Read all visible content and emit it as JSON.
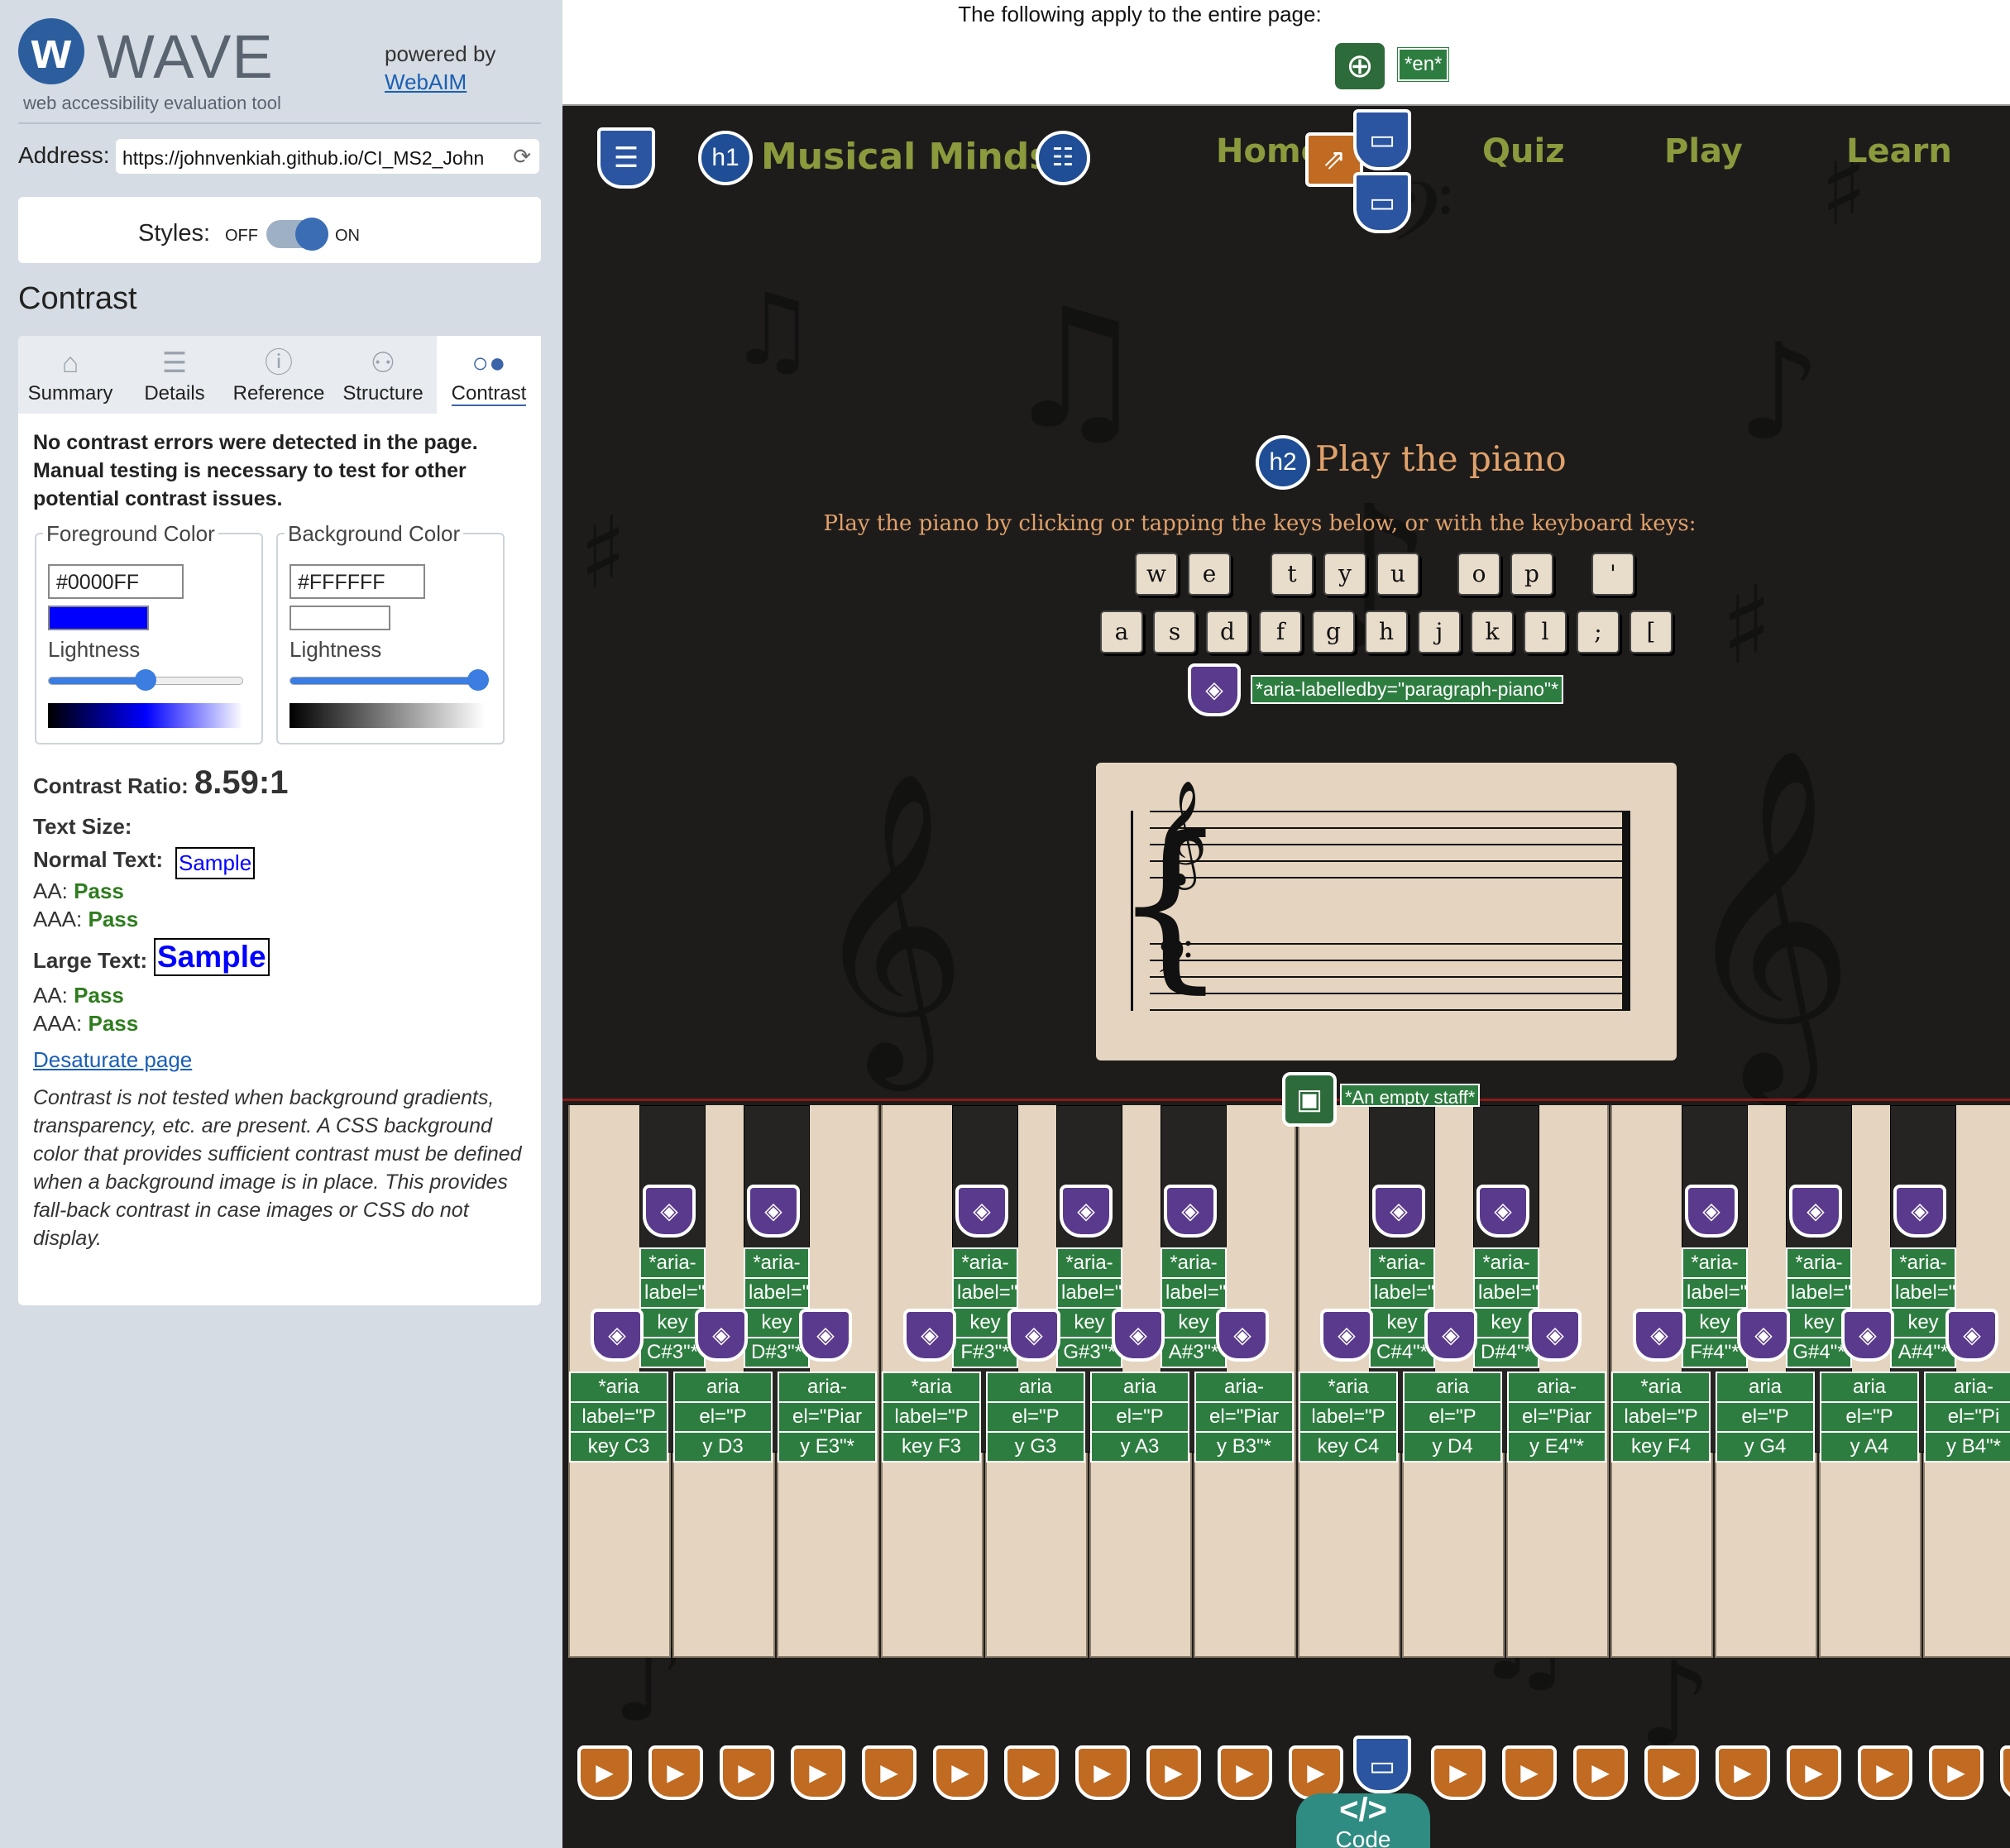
{
  "sidebar": {
    "logo_word": "WAVE",
    "logo_sub": "web accessibility evaluation tool",
    "powered_by": "powered by",
    "powered_link": "WebAIM",
    "address_label": "Address:",
    "address_value": "https://johnvenkiah.github.io/CI_MS2_John",
    "styles_label": "Styles:",
    "styles_off": "OFF",
    "styles_on": "ON",
    "panel_title": "Contrast",
    "tabs": [
      {
        "label": "Summary",
        "icon": "home-icon"
      },
      {
        "label": "Details",
        "icon": "list-icon"
      },
      {
        "label": "Reference",
        "icon": "info-icon"
      },
      {
        "label": "Structure",
        "icon": "structure-icon"
      },
      {
        "label": "Contrast",
        "icon": "contrast-icon"
      }
    ],
    "message": "No contrast errors were detected in the page. Manual testing is necessary to test for other potential contrast issues.",
    "foreground": {
      "legend": "Foreground Color",
      "hex": "#0000FF",
      "lightness_label": "Lightness",
      "lightness": 0.5
    },
    "background": {
      "legend": "Background Color",
      "hex": "#FFFFFF",
      "lightness_label": "Lightness",
      "lightness": 0.97
    },
    "ratio_label": "Contrast Ratio:",
    "ratio_value": "8.59:1",
    "text_size_label": "Text Size:",
    "normal_text_label": "Normal Text:",
    "sample": "Sample",
    "normal_aa_label": "AA:",
    "normal_aa": "Pass",
    "normal_aaa_label": "AAA:",
    "normal_aaa": "Pass",
    "large_text_label": "Large Text:",
    "large_aa_label": "AA:",
    "large_aa": "Pass",
    "large_aaa_label": "AAA:",
    "large_aaa": "Pass",
    "desaturate": "Desaturate page",
    "note": "Contrast is not tested when background gradients, transparency, etc. are present. A CSS background color that provides sufficient contrast must be defined when a background image is in place. This provides fall-back contrast in case images or CSS do not display."
  },
  "page": {
    "apply_text": "The following apply to the entire page:",
    "lang_tag": "*en*",
    "brand_badge": "h1",
    "brand": "Musical Minds",
    "nav": [
      "Home",
      "Quiz",
      "Play",
      "Learn"
    ],
    "h2_badge": "h2",
    "heading": "Play the piano",
    "instructions": "Play the piano by clicking or tapping the keys below, or with the keyboard keys:",
    "top_keys": [
      "w",
      "e",
      "t",
      "y",
      "u",
      "o",
      "p",
      "'"
    ],
    "bottom_keys": [
      "a",
      "s",
      "d",
      "f",
      "g",
      "h",
      "j",
      "k",
      "l",
      ";",
      "["
    ],
    "labelledby": "*aria-labelledby=\"paragraph-piano\"*",
    "staff_alt": "*An empty staff*",
    "black_labels": [
      [
        "*aria-",
        "label=\"Pian",
        "key",
        "C#3\"*"
      ],
      [
        "*aria-",
        "label=\"Piano",
        "key",
        "D#3\"*"
      ],
      [
        "*aria-",
        "label=\"Pian",
        "key",
        "F#3\"*"
      ],
      [
        "*aria-",
        "label=\"Pian",
        "key",
        "G#3\"*"
      ],
      [
        "*aria-",
        "label=\"Piano",
        "key",
        "A#3\"*"
      ],
      [
        "*aria-",
        "label=\"Pian",
        "key",
        "C#4\"*"
      ],
      [
        "*aria-",
        "label=\"Piano",
        "key",
        "D#4\"*"
      ],
      [
        "*aria-",
        "label=\"Pian",
        "key",
        "F#4\"*"
      ],
      [
        "*aria-",
        "label=\"Pian",
        "key",
        "G#4\"*"
      ],
      [
        "*aria-",
        "label=\"Piano",
        "key",
        "A#4\"*"
      ]
    ],
    "white_labels": [
      [
        "*aria",
        "label=\"P",
        "key C3"
      ],
      [
        "aria",
        "el=\"P",
        "y D3"
      ],
      [
        "aria-",
        "el=\"Piar",
        "y E3\"*"
      ],
      [
        "*aria",
        "label=\"P",
        "key F3"
      ],
      [
        "aria",
        "el=\"P",
        "y G3"
      ],
      [
        "aria",
        "el=\"P",
        "y A3"
      ],
      [
        "aria-",
        "el=\"Piar",
        "y B3\"*"
      ],
      [
        "*aria",
        "label=\"P",
        "key C4"
      ],
      [
        "aria",
        "el=\"P",
        "y D4"
      ],
      [
        "aria-",
        "el=\"Piar",
        "y E4\"*"
      ],
      [
        "*aria",
        "label=\"P",
        "key F4"
      ],
      [
        "aria",
        "el=\"P",
        "y G4"
      ],
      [
        "aria",
        "el=\"P",
        "y A4"
      ],
      [
        "aria-",
        "el=\"Pi",
        "y B4\"*"
      ]
    ],
    "code_label": "Code"
  },
  "colors": {
    "foreground": "#0000FF",
    "background": "#FFFFFF",
    "pass": "#2e7d1e",
    "aria_tag": "#5a3a8c",
    "alert": "#c06a22"
  }
}
